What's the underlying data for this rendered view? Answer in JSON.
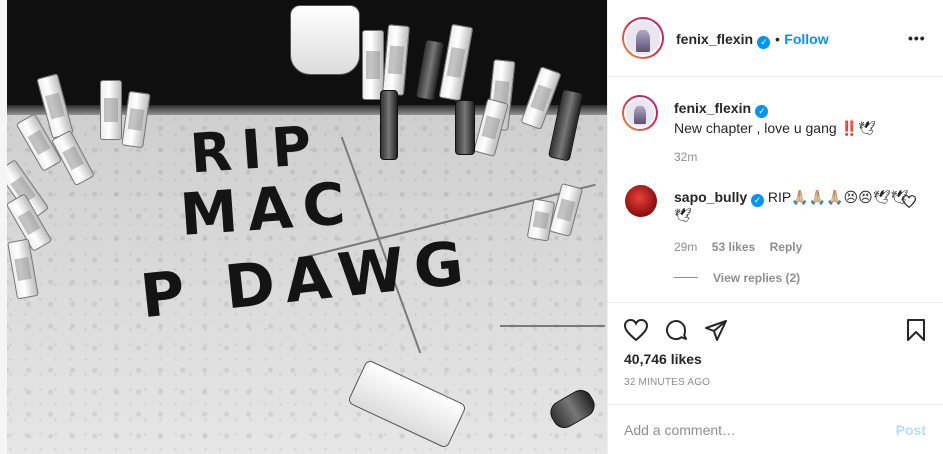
{
  "post": {
    "username": "fenix_flexin",
    "follow_label": "Follow",
    "separator": "•",
    "more_icon": "more-horizontal-icon",
    "image_alt_text": {
      "graffiti_line1": "RIP",
      "graffiti_line2": "MAC",
      "graffiti_line3": "P DAWG"
    }
  },
  "caption": {
    "username": "fenix_flexin",
    "text": "New chapter , love u gang ‼️🕊",
    "time": "32m"
  },
  "comments": [
    {
      "username": "sapo_bully",
      "text": "RIP🙏🏼🙏🏼🙏🏼😣😣🕊🕊",
      "text_line2": "🕊",
      "time": "29m",
      "likes": "53 likes",
      "reply_label": "Reply",
      "view_replies": "View replies (2)"
    }
  ],
  "actions": {
    "likes": "40,746 likes",
    "posted_ago": "32 MINUTES AGO",
    "comment_placeholder": "Add a comment…",
    "post_label": "Post"
  },
  "colors": {
    "link_blue": "#0095f6",
    "post_disabled": "#b2dffc",
    "muted": "#8e8e8e",
    "text": "#262626"
  }
}
